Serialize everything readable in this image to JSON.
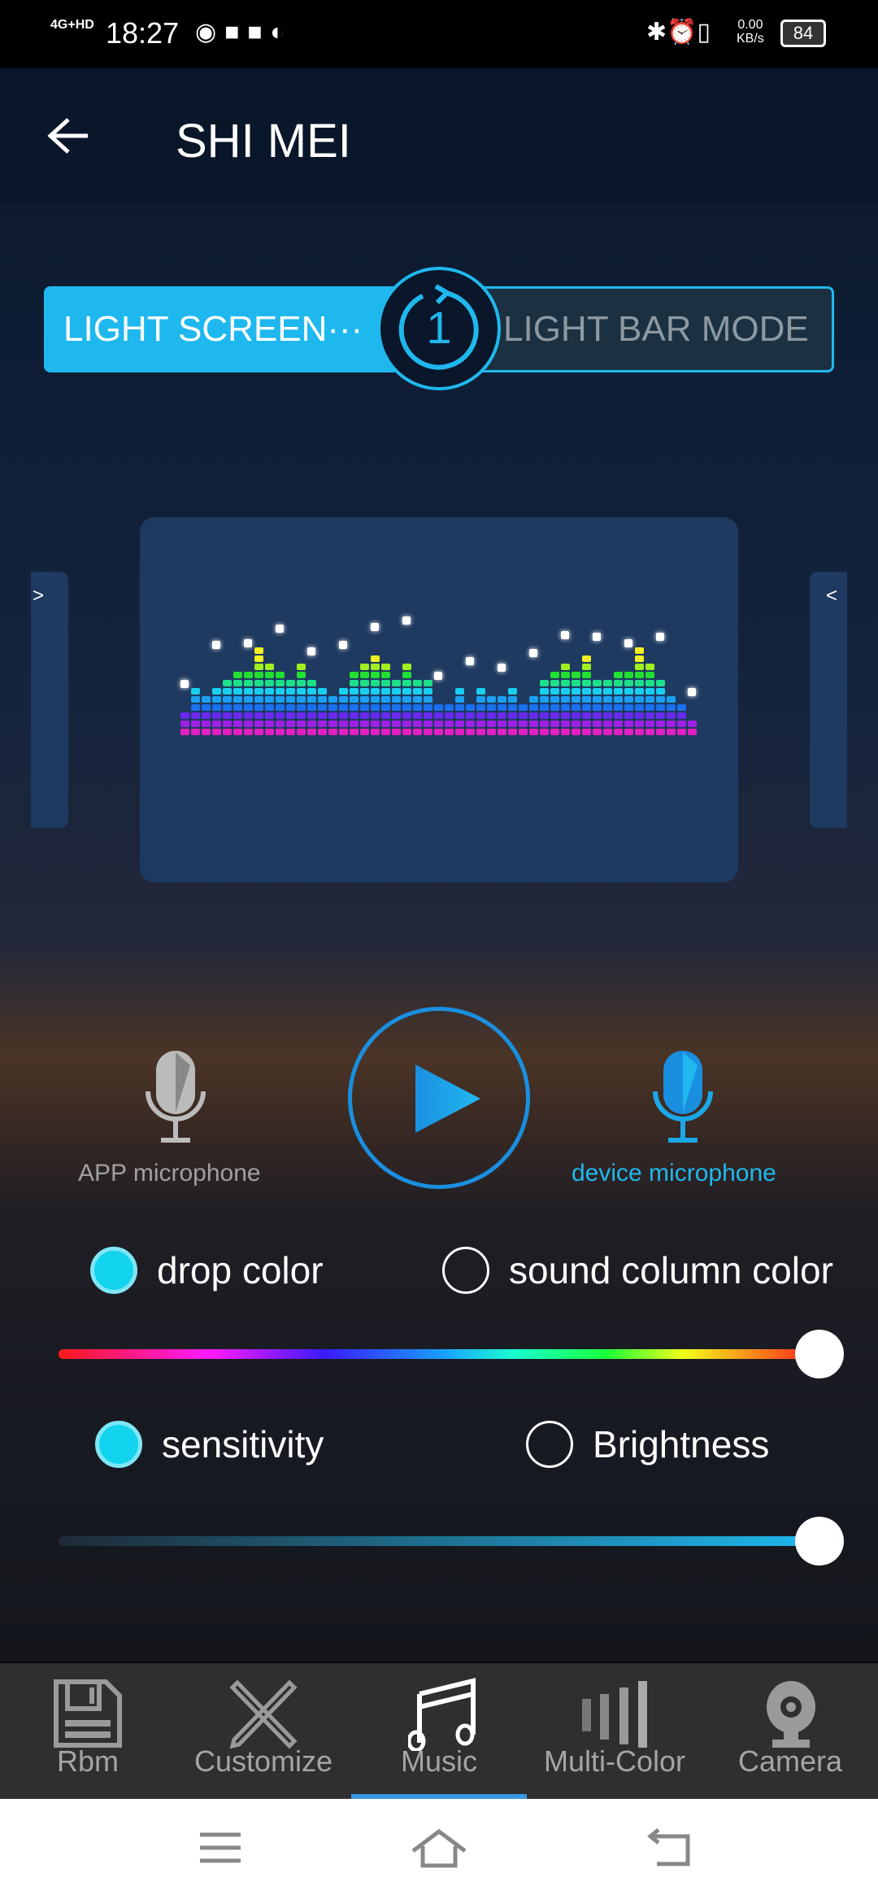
{
  "status_bar": {
    "network": "4G+HD",
    "time": "18:27",
    "speed": "0.00",
    "speed_unit": "KB/s",
    "battery": "84"
  },
  "header": {
    "title": "SHI MEI"
  },
  "mode_toggle": {
    "left_label": "LIGHT SCREEN···",
    "right_label": "LIGHT BAR MODE",
    "center_number": "1",
    "active": "left"
  },
  "mic": {
    "app_label": "APP microphone",
    "device_label": "device microphone",
    "active": "device"
  },
  "color_options": {
    "option1": "drop color",
    "option2": "sound column color",
    "selected": "drop color",
    "slider_value_percent": 100
  },
  "level_options": {
    "option1": "sensitivity",
    "option2": "Brightness",
    "selected": "sensitivity",
    "slider_value_percent": 100
  },
  "nav": {
    "items": [
      {
        "label": "Rbm",
        "icon": "floppy-disk-icon"
      },
      {
        "label": "Customize",
        "icon": "pencil-ruler-icon"
      },
      {
        "label": "Music",
        "icon": "music-note-icon"
      },
      {
        "label": "Multi-Color",
        "icon": "bars-icon"
      },
      {
        "label": "Camera",
        "icon": "webcam-icon"
      }
    ],
    "active": "Music"
  },
  "colors": {
    "accent": "#1fb8ee",
    "card": "#1f3a60",
    "nav_bg": "#2f2f2f",
    "active_indicator": "#3b97e0"
  }
}
